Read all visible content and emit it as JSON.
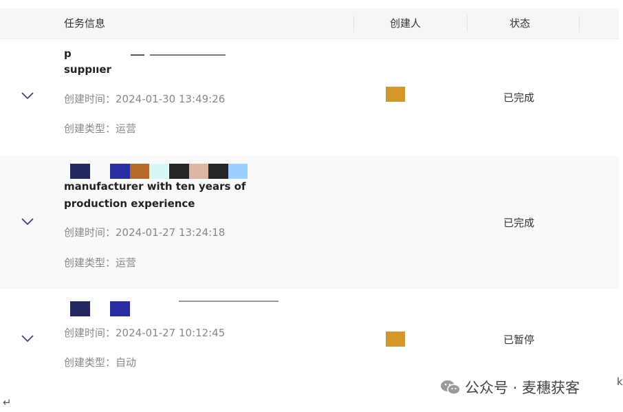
{
  "header": {
    "task_info": "任务信息",
    "creator": "创建人",
    "status": "状态"
  },
  "rows": [
    {
      "title_lines": [
        "p",
        "supplier"
      ],
      "created_time_label": "创建时间：",
      "created_time": "2024-01-30 13:49:26",
      "created_type_label": "创建类型：",
      "created_type": "运营",
      "status": "已完成",
      "creator_color": "#d4972a"
    },
    {
      "title_lines": [
        "manufacturer with ten years of",
        "production experience"
      ],
      "created_time_label": "创建时间：",
      "created_time": "2024-01-27 13:24:18",
      "created_type_label": "创建类型：",
      "created_type": "运营",
      "status": "已完成",
      "color_blocks": [
        "#252860",
        "#2a2ea3",
        "#b46a2a",
        "#d8f6f6",
        "#262626",
        "#dbb6a4",
        "#262626",
        "#9ad0ff"
      ]
    },
    {
      "created_time_label": "创建时间：",
      "created_time": "2024-01-27 10:12:45",
      "created_type_label": "创建类型：",
      "created_type": "自动",
      "status": "已暂停",
      "creator_color": "#d4972a",
      "color_blocks": [
        "#252860",
        "#2a2ea3"
      ]
    }
  ],
  "watermark": {
    "text": "公众号 · 麦穗获客",
    "icon": "wechat-icon"
  },
  "misc": {
    "para_mark": "↵",
    "edge_mark": "k"
  }
}
